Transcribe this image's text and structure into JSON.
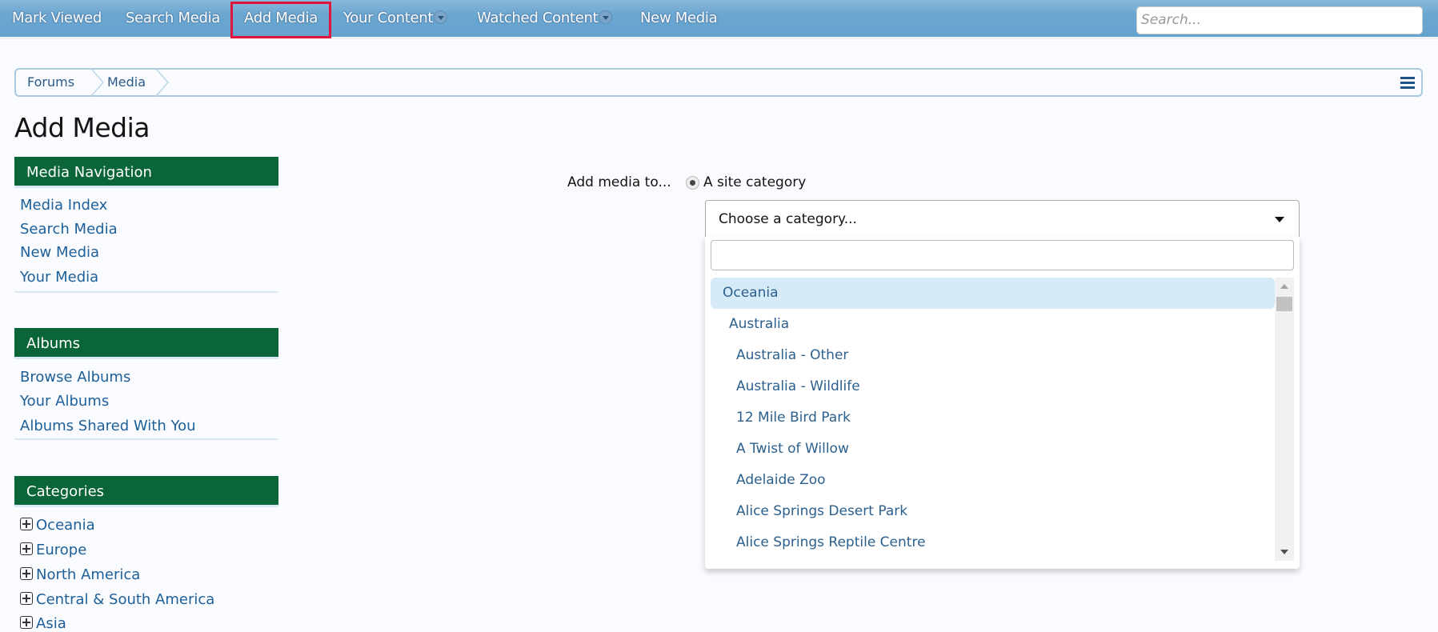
{
  "nav": {
    "items": [
      "Mark Viewed",
      "Search Media",
      "Add Media",
      "Your Content",
      "Watched Content",
      "New Media"
    ],
    "search_placeholder": "Search..."
  },
  "breadcrumb": [
    "Forums",
    "Media"
  ],
  "page_title": "Add Media",
  "sidebar": {
    "media_nav": {
      "title": "Media Navigation",
      "links": [
        "Media Index",
        "Search Media",
        "New Media",
        "Your Media"
      ]
    },
    "albums": {
      "title": "Albums",
      "links": [
        "Browse Albums",
        "Your Albums",
        "Albums Shared With You"
      ]
    },
    "categories": {
      "title": "Categories",
      "items": [
        "Oceania",
        "Europe",
        "North America",
        "Central & South America",
        "Asia"
      ]
    }
  },
  "form": {
    "label": "Add media to...",
    "radio_label": "A site category",
    "select_placeholder": "Choose a category...",
    "options": [
      "Oceania",
      "Australia",
      "Australia - Other",
      "Australia - Wildlife",
      "12 Mile Bird Park",
      "A Twist of Willow",
      "Adelaide Zoo",
      "Alice Springs Desert Park",
      "Alice Springs Reptile Centre"
    ]
  }
}
